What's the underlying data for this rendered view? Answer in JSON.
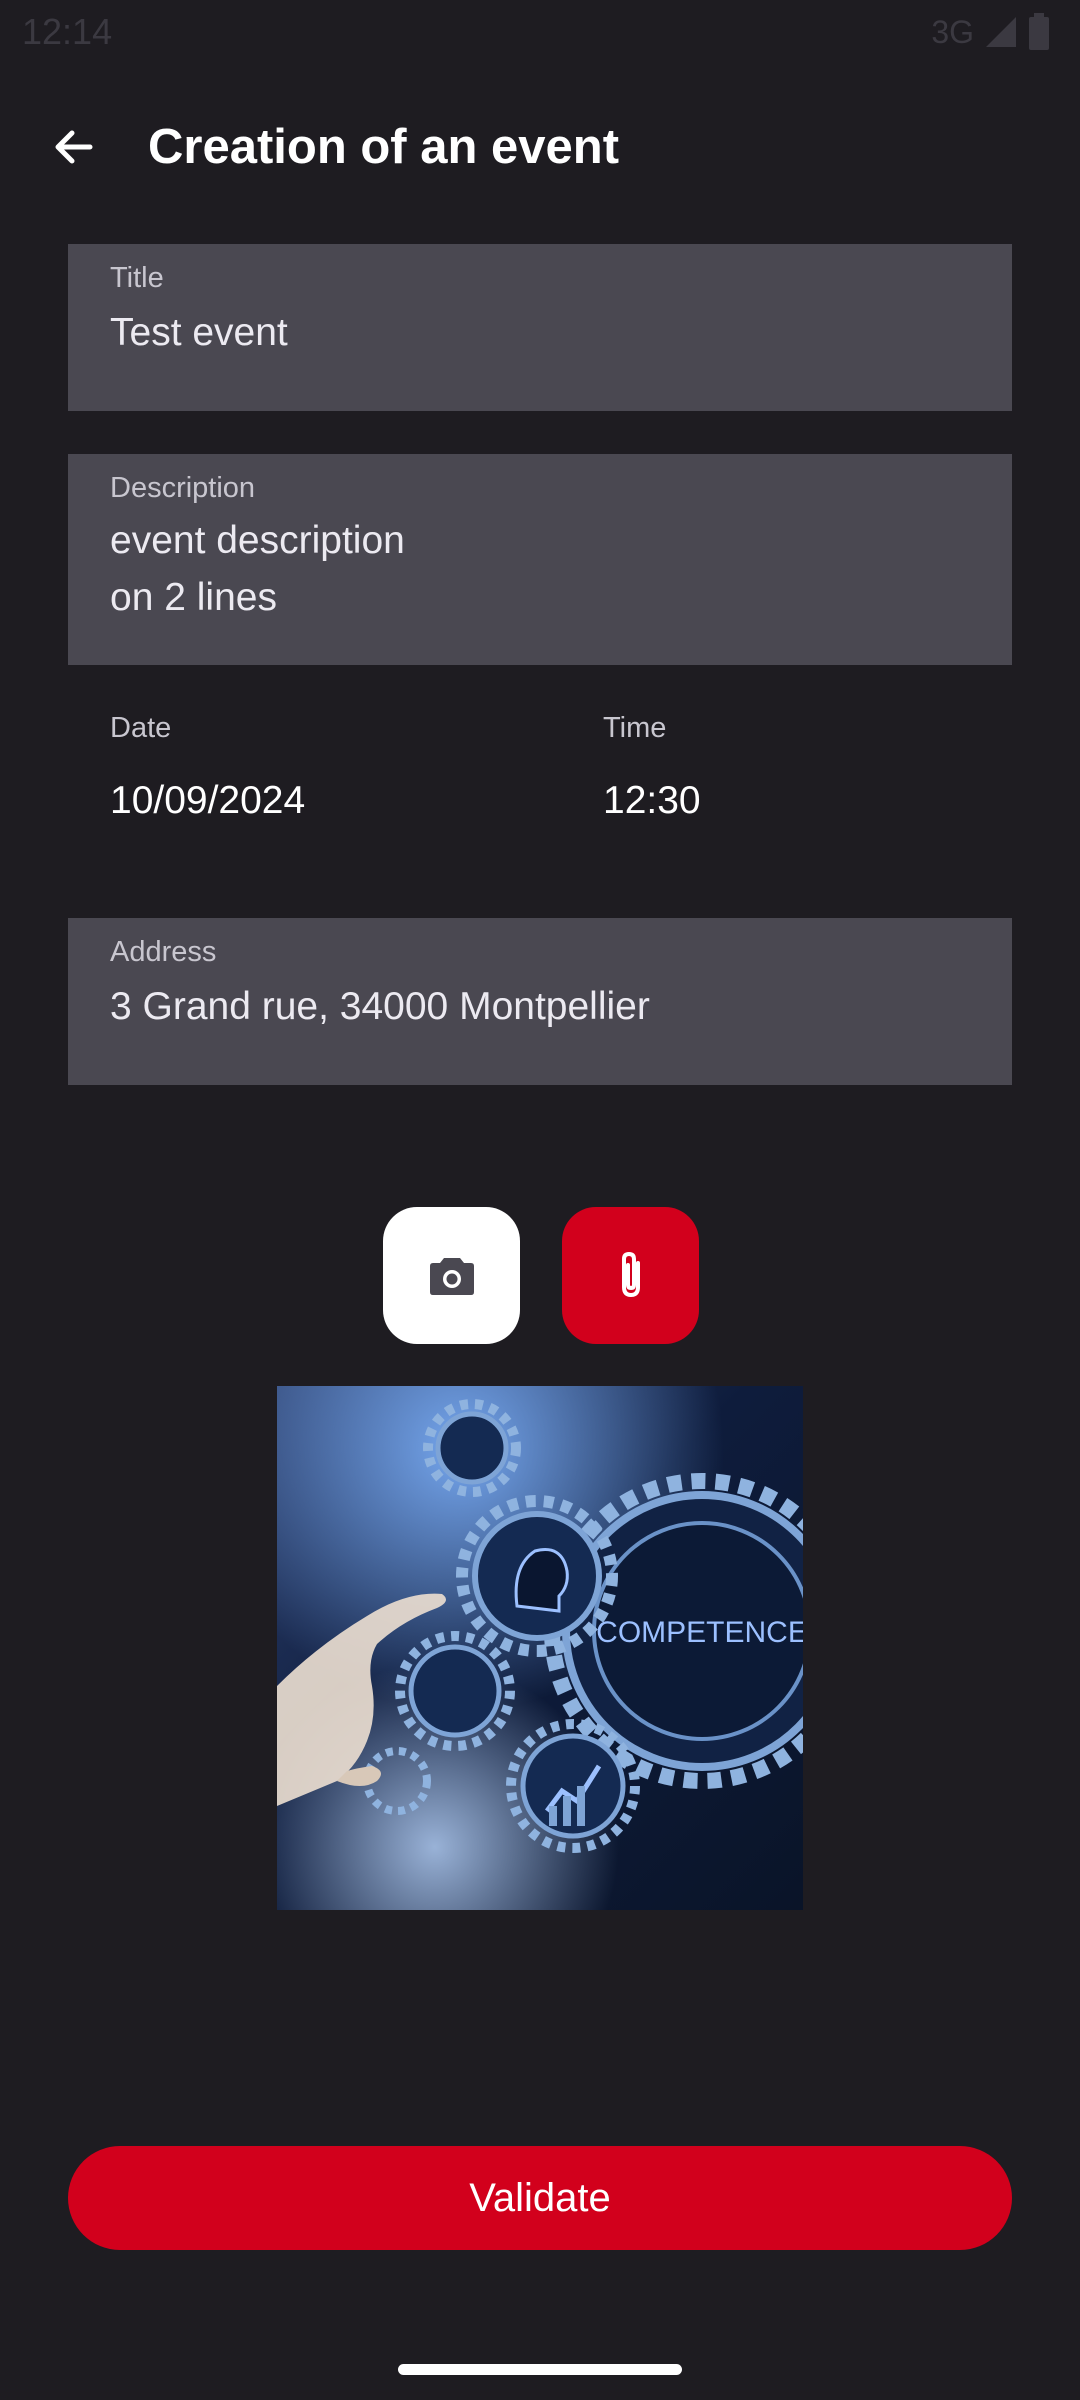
{
  "status_bar": {
    "time": "12:14",
    "network": "3G",
    "icons": [
      "signal-icon",
      "battery-icon"
    ]
  },
  "app_bar": {
    "back_icon": "arrow-back-icon",
    "title": "Creation of an event"
  },
  "form": {
    "title": {
      "label": "Title",
      "value": "Test event"
    },
    "description": {
      "label": "Description",
      "value": "event description\non 2 lines"
    },
    "date": {
      "label": "Date",
      "value": "10/09/2024"
    },
    "time": {
      "label": "Time",
      "value": "12:30"
    },
    "address": {
      "label": "Address",
      "value": "3 Grand rue, 34000 Montpellier"
    }
  },
  "media_buttons": {
    "camera_icon": "camera-icon",
    "attach_icon": "paperclip-icon"
  },
  "image": {
    "caption_text": "COMPETENCE"
  },
  "validate_label": "Validate",
  "colors": {
    "background": "#1e1c21",
    "field_fill": "#4a4851",
    "accent": "#d2001c",
    "text": "#ffffff",
    "label": "#c8c6cf"
  }
}
